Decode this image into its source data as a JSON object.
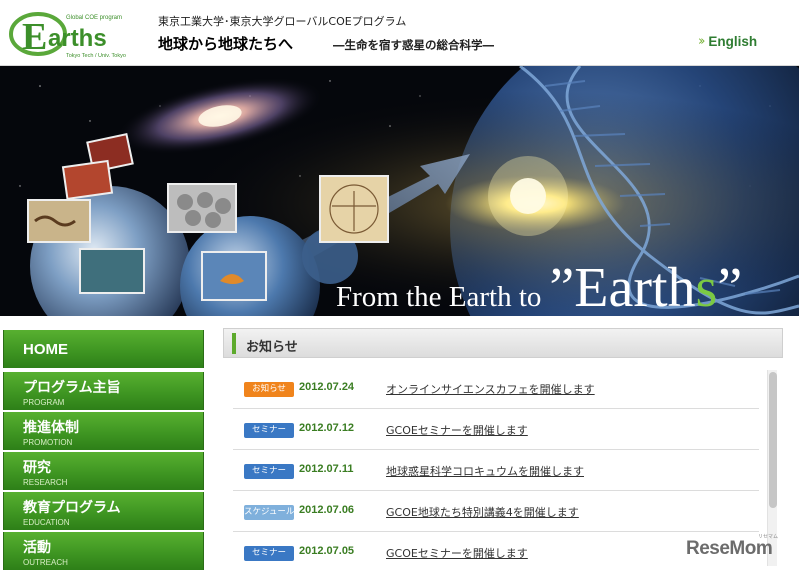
{
  "header": {
    "logo_text": "Earths",
    "logo_program": "Global COE program",
    "logo_sub": "Tokyo Tech / Univ. Tokyo",
    "org": "東京工業大学･東京大学グローバルCOEプログラム",
    "title": "地球から地球たちへ",
    "subtitle": "―生命を宿す惑星の総合科学―",
    "english_label": "English",
    "english_icon": "double-chevron-right-icon"
  },
  "banner": {
    "tagline_lead": "From the Earth to",
    "tagline_quote_open": "”",
    "tagline_main": "Earth",
    "tagline_s": "s",
    "tagline_quote_close": "”"
  },
  "sidebar": {
    "items": [
      {
        "jp": "HOME",
        "en": ""
      },
      {
        "jp": "プログラム主旨",
        "en": "PROGRAM"
      },
      {
        "jp": "推進体制",
        "en": "PROMOTION"
      },
      {
        "jp": "研究",
        "en": "RESEARCH"
      },
      {
        "jp": "教育プログラム",
        "en": "EDUCATION"
      },
      {
        "jp": "活動",
        "en": "OUTREACH"
      }
    ]
  },
  "news": {
    "heading": "お知らせ",
    "items": [
      {
        "tag": "お知らせ",
        "tag_color": "#f0841c",
        "date": "2012.07.24",
        "title": "オンラインサイエンスカフェを開催します"
      },
      {
        "tag": "セミナー",
        "tag_color": "#3a78c4",
        "date": "2012.07.12",
        "title": "GCOEセミナーを開催します"
      },
      {
        "tag": "セミナー",
        "tag_color": "#3a78c4",
        "date": "2012.07.11",
        "title": "地球惑星科学コロキュウムを開催します"
      },
      {
        "tag": "スケジュール",
        "tag_color": "#7fb0dc",
        "date": "2012.07.06",
        "title": "GCOE地球たち特別講義4を開催します"
      },
      {
        "tag": "セミナー",
        "tag_color": "#3a78c4",
        "date": "2012.07.05",
        "title": "GCOEセミナーを開催します"
      }
    ]
  },
  "watermark": {
    "text": "ReseMom",
    "small": "リセマム"
  }
}
